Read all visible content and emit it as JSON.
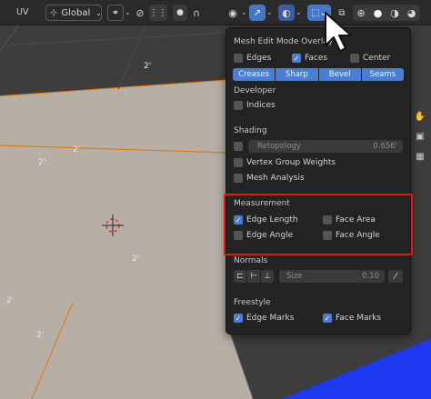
{
  "toolbar": {
    "uv_label": "UV",
    "orientation_label": "Global"
  },
  "viewport": {
    "dims": [
      "2'",
      "2'",
      "2'",
      "2'",
      "2'",
      "2'"
    ]
  },
  "overlay": {
    "title": "Mesh Edit Mode Overlay",
    "edges_label": "Edges",
    "faces_label": "Faces",
    "center_label": "Center",
    "edges_checked": false,
    "faces_checked": true,
    "center_checked": false,
    "tabs": [
      "Creases",
      "Sharp",
      "Bevel",
      "Seams"
    ],
    "developer_title": "Developer",
    "indices_label": "Indices",
    "shading_title": "Shading",
    "retopology_label": "Retopology",
    "retopology_value": "0.656'",
    "vertex_group_weights_label": "Vertex Group Weights",
    "mesh_analysis_label": "Mesh Analysis",
    "measurement_title": "Measurement",
    "edge_length_label": "Edge Length",
    "face_area_label": "Face Area",
    "edge_angle_label": "Edge Angle",
    "face_angle_label": "Face Angle",
    "edge_length_checked": true,
    "normals_title": "Normals",
    "size_label": "Size",
    "size_value": "0.10",
    "freestyle_title": "Freestyle",
    "edge_marks_label": "Edge Marks",
    "face_marks_label": "Face Marks",
    "edge_marks_checked": true,
    "face_marks_checked": true
  },
  "colors": {
    "accent": "#4a7ed0",
    "highlight_border": "#e01818",
    "mesh_face": "#b7aea6",
    "corner_blue": "#1d39f0"
  }
}
